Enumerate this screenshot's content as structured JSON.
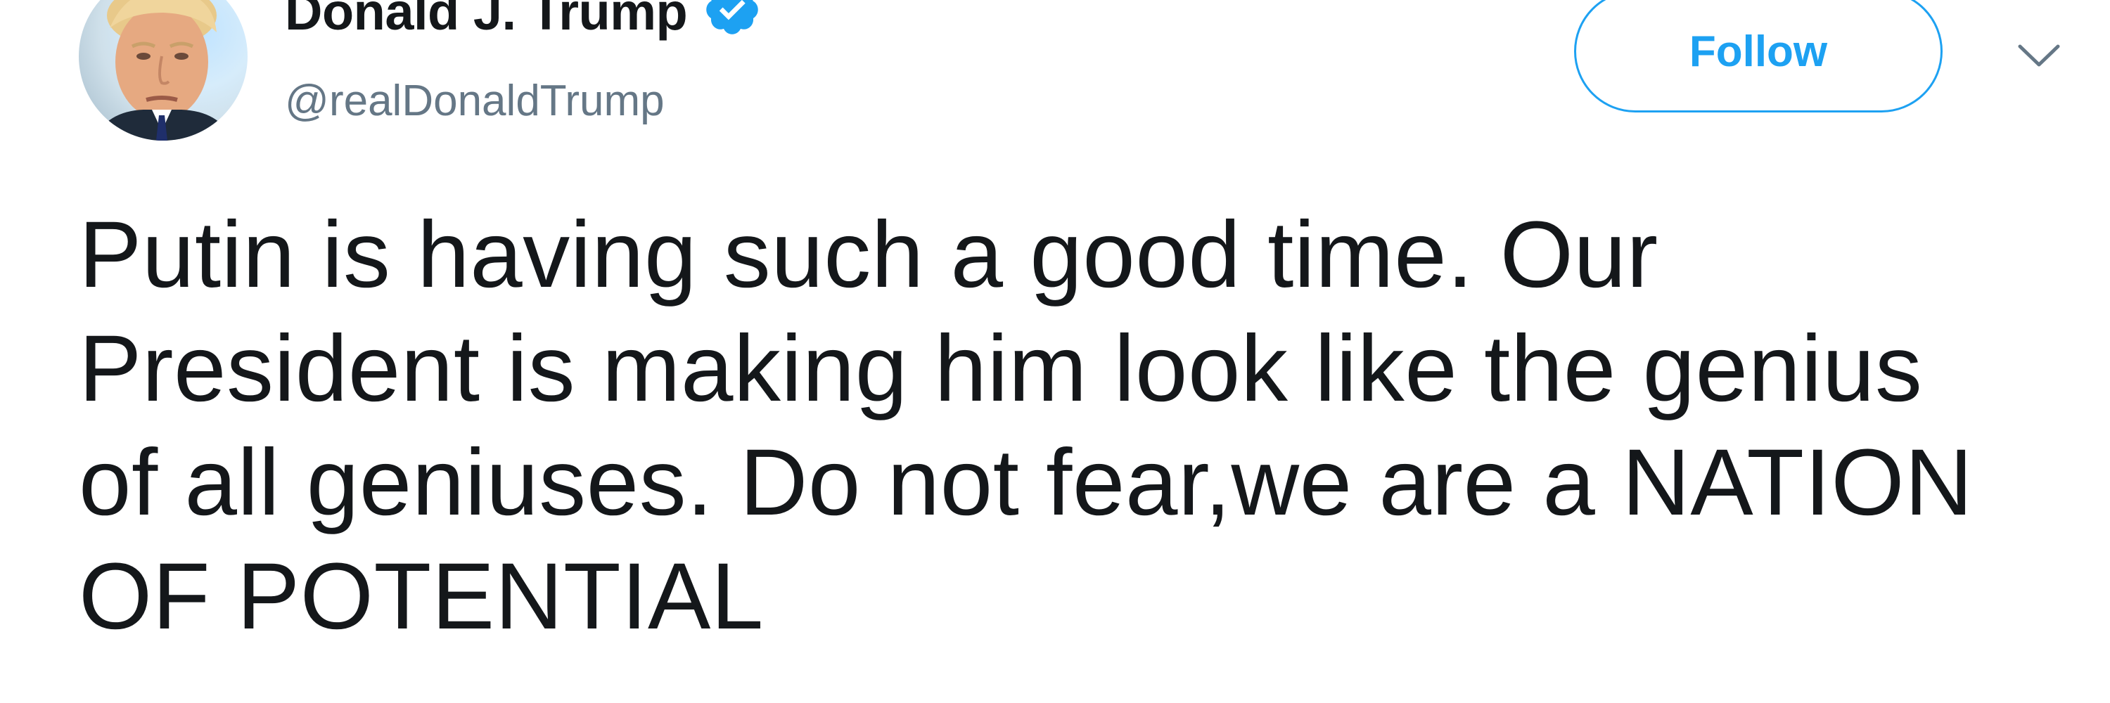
{
  "author": {
    "display_name": "Donald J. Trump",
    "handle": "@realDonaldTrump",
    "verified": true,
    "avatar_icon": "profile-photo"
  },
  "actions": {
    "follow_label": "Follow",
    "menu_icon": "chevron-down-icon"
  },
  "tweet": {
    "text_lines": [
      "Putin is having such a good time. Our",
      "President is making him look like the genius",
      "of all geniuses. Do not fear,we are a NATION",
      "OF POTENTIAL"
    ]
  },
  "colors": {
    "accent": "#1da1f2",
    "text": "#14171a",
    "secondary_text": "#657786"
  }
}
